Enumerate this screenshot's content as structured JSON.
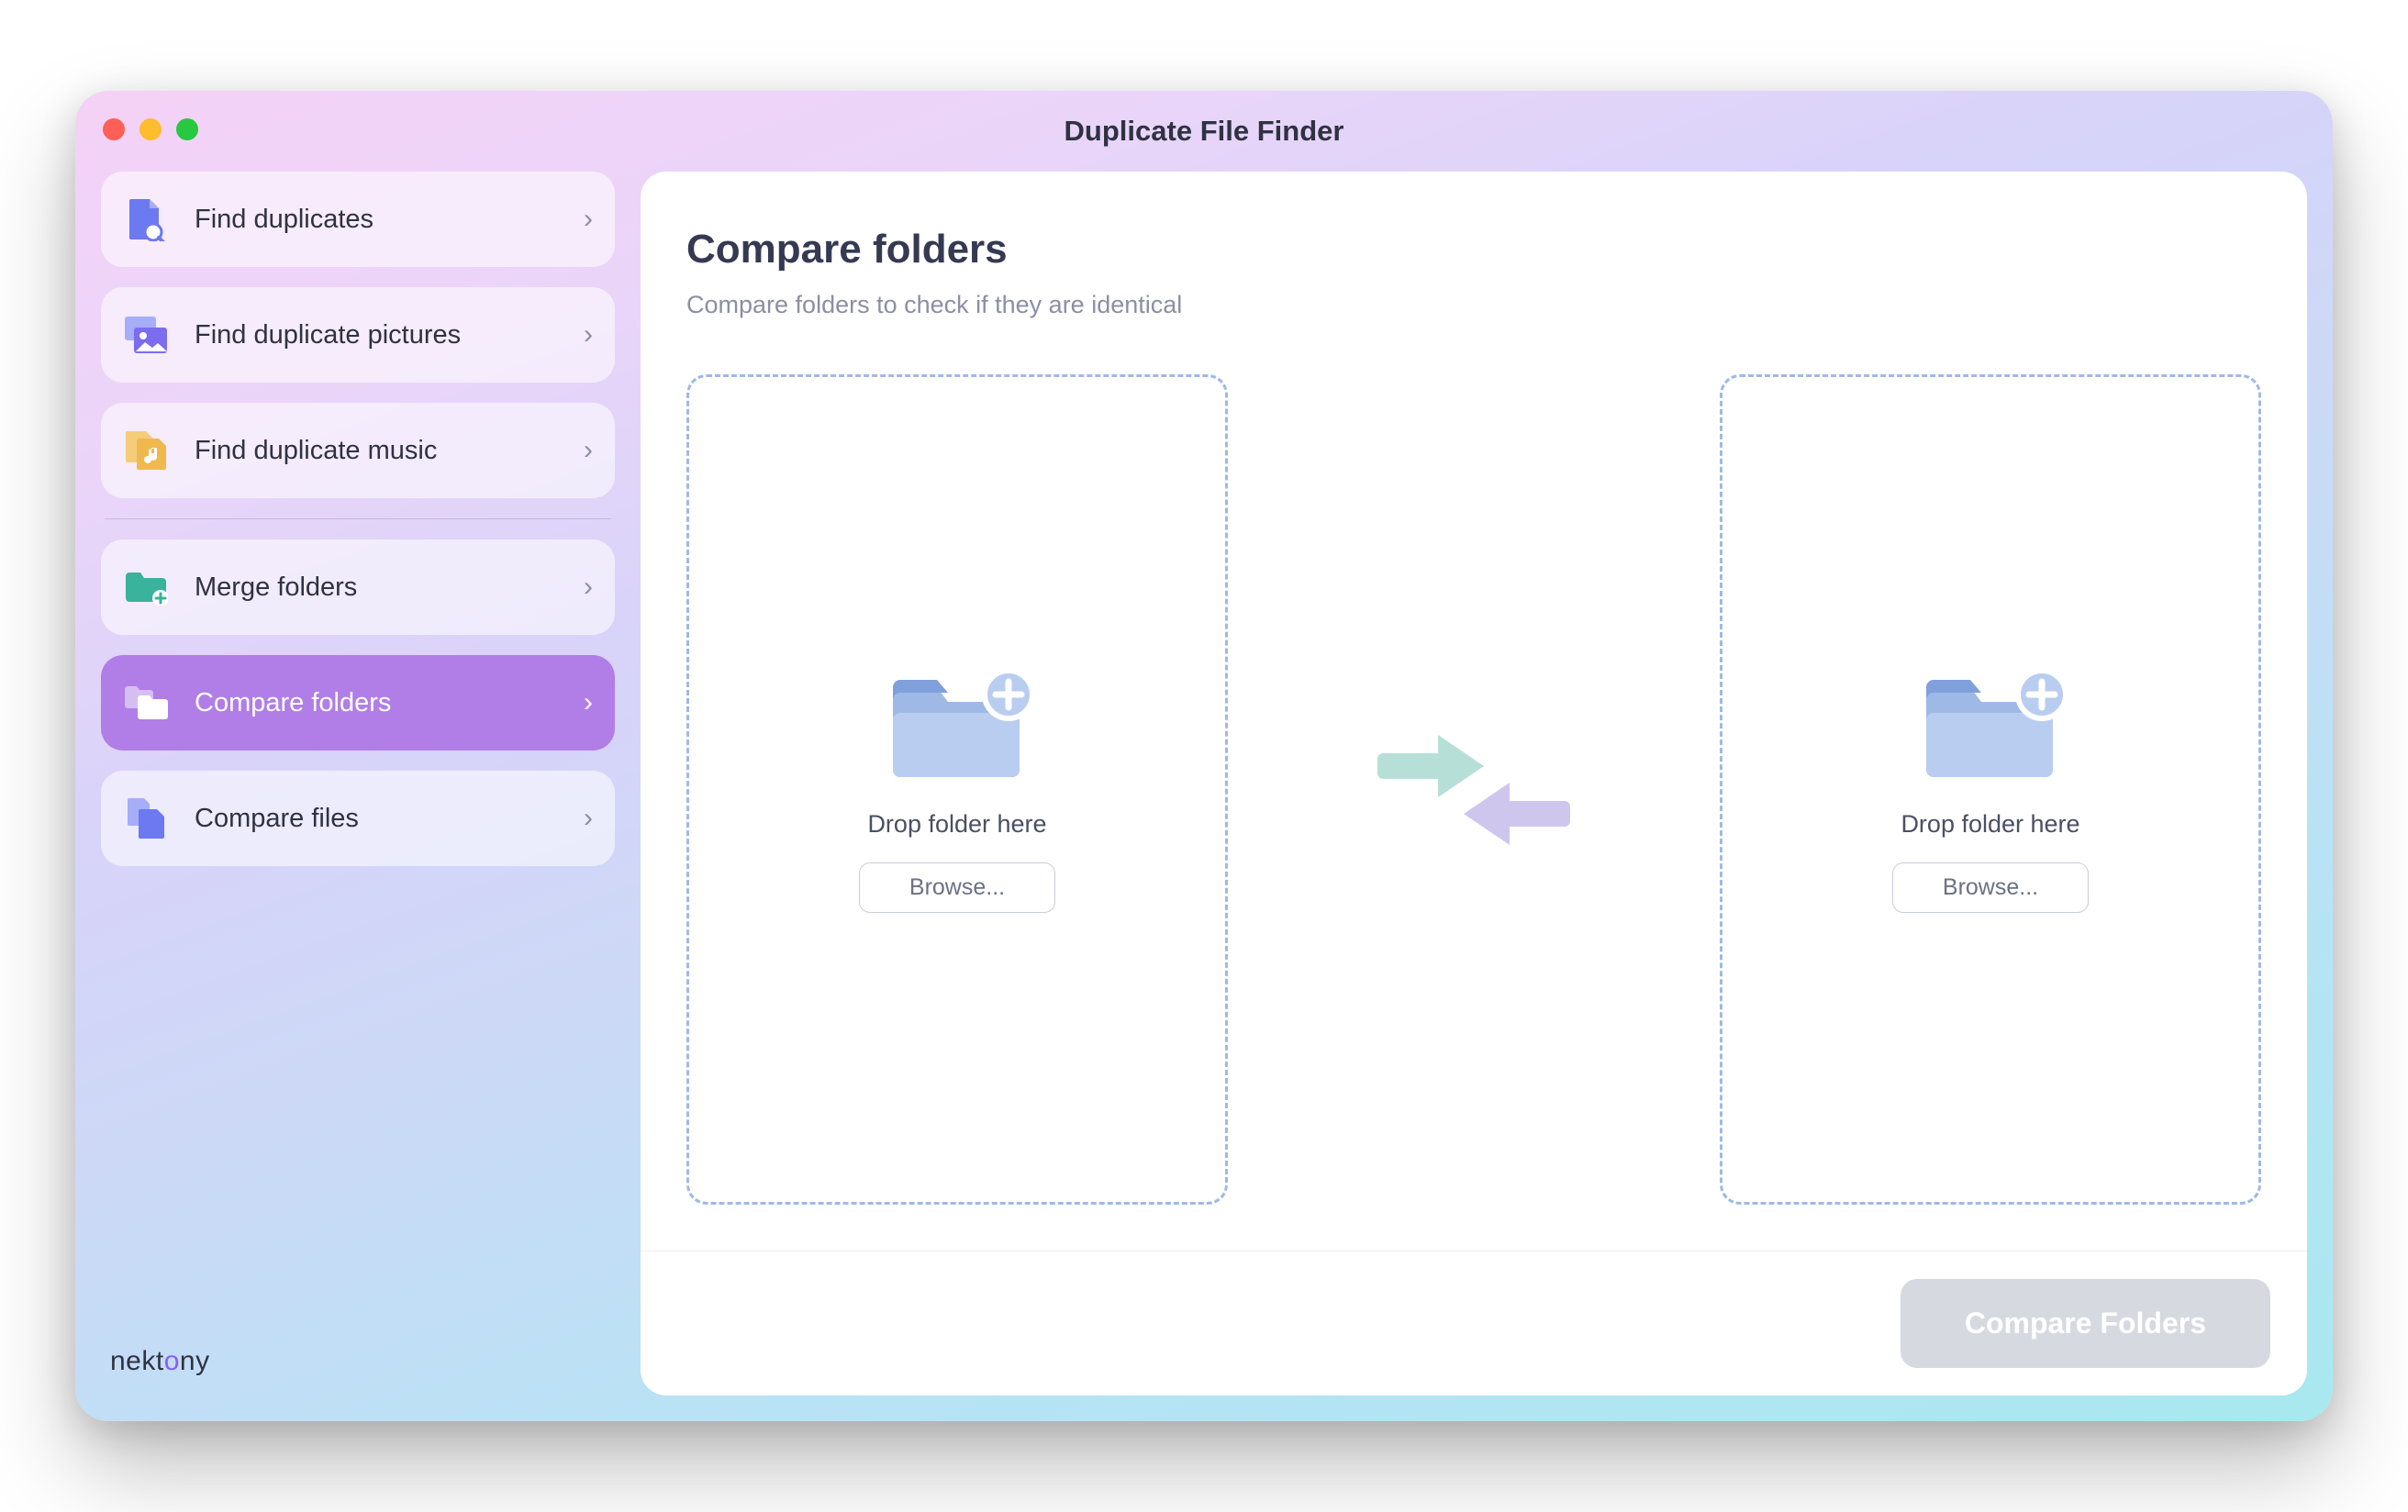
{
  "window": {
    "title": "Duplicate File Finder"
  },
  "sidebar": {
    "groups": [
      [
        {
          "id": "find-duplicates",
          "label": "Find duplicates",
          "icon": "file-search",
          "color": "#6c79f0",
          "active": false
        },
        {
          "id": "find-duplicate-pictures",
          "label": "Find duplicate pictures",
          "icon": "pictures",
          "color": "#7b6cf0",
          "active": false
        },
        {
          "id": "find-duplicate-music",
          "label": "Find duplicate music",
          "icon": "music",
          "color": "#f0b94e",
          "active": false
        }
      ],
      [
        {
          "id": "merge-folders",
          "label": "Merge folders",
          "icon": "folder-plus",
          "color": "#39b39b",
          "active": false
        },
        {
          "id": "compare-folders",
          "label": "Compare folders",
          "icon": "folder-compare",
          "color": "#ffffff",
          "active": true
        },
        {
          "id": "compare-files",
          "label": "Compare files",
          "icon": "file-compare",
          "color": "#6c79f0",
          "active": false
        }
      ]
    ]
  },
  "brand": "nektony",
  "main": {
    "title": "Compare folders",
    "subtitle": "Compare folders to check if they are identical",
    "dropzones": [
      {
        "label": "Drop folder here",
        "browse": "Browse..."
      },
      {
        "label": "Drop folder here",
        "browse": "Browse..."
      }
    ],
    "compare_button": "Compare Folders"
  }
}
